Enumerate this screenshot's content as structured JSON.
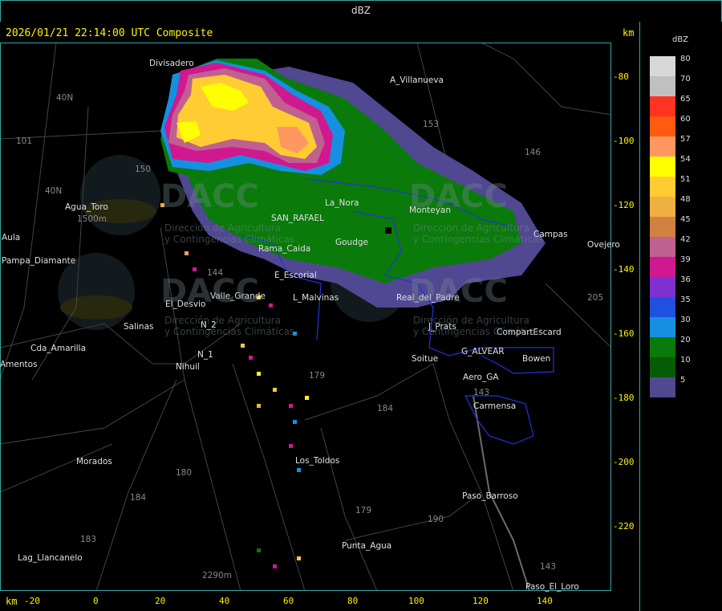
{
  "header": {
    "title": "dBZ"
  },
  "timestamp": "2026/01/21 22:14:00 UTC Composite",
  "axis": {
    "unit": "km",
    "y_ticks": [
      "-80",
      "-100",
      "-120",
      "-140",
      "-160",
      "-180",
      "-200",
      "-220"
    ],
    "x_ticks": [
      "-20",
      "0",
      "20",
      "40",
      "60",
      "80",
      "100",
      "120",
      "140"
    ]
  },
  "legend": {
    "title": "dBZ",
    "entries": [
      {
        "label": "80",
        "color": "#d8d8d8"
      },
      {
        "label": "70",
        "color": "#c0c0c0"
      },
      {
        "label": "65",
        "color": "#ff3322"
      },
      {
        "label": "60",
        "color": "#ff5a10"
      },
      {
        "label": "57",
        "color": "#ff9860"
      },
      {
        "label": "54",
        "color": "#ffff00"
      },
      {
        "label": "51",
        "color": "#ffcc33"
      },
      {
        "label": "48",
        "color": "#f0b040"
      },
      {
        "label": "45",
        "color": "#d08040"
      },
      {
        "label": "42",
        "color": "#c06090"
      },
      {
        "label": "39",
        "color": "#d01890"
      },
      {
        "label": "36",
        "color": "#8030d0"
      },
      {
        "label": "35",
        "color": "#2050e0"
      },
      {
        "label": "30",
        "color": "#1590e0"
      },
      {
        "label": "20",
        "color": "#0a7a0a"
      },
      {
        "label": "10",
        "color": "#055c05"
      },
      {
        "label": "5",
        "color": "#504890"
      }
    ]
  },
  "places": [
    {
      "name": "Divisadero"
    },
    {
      "name": "A_Villanueva"
    },
    {
      "name": "40N"
    },
    {
      "name": "101"
    },
    {
      "name": "150"
    },
    {
      "name": "153"
    },
    {
      "name": "146"
    },
    {
      "name": "40N"
    },
    {
      "name": "Agua_Toro"
    },
    {
      "name": "1500m"
    },
    {
      "name": "Aula"
    },
    {
      "name": "Pampa_Diamante"
    },
    {
      "name": "Los_Toldos"
    },
    {
      "name": "Salinas"
    },
    {
      "name": "Cda_Amarilla"
    },
    {
      "name": "Amentos"
    },
    {
      "name": "El_Desvio"
    },
    {
      "name": "Valle_Grande"
    },
    {
      "name": "N_2"
    },
    {
      "name": "N_1"
    },
    {
      "name": "Nihuil"
    },
    {
      "name": "Morados"
    },
    {
      "name": "180"
    },
    {
      "name": "184"
    },
    {
      "name": "183"
    },
    {
      "name": "Lag_Llancanelo"
    },
    {
      "name": "Punta_Agua"
    },
    {
      "name": "2290m"
    },
    {
      "name": "179"
    },
    {
      "name": "190"
    },
    {
      "name": "Paso_Barroso"
    },
    {
      "name": "Paso_El_Loro"
    },
    {
      "name": "143"
    },
    {
      "name": "Carmensa"
    },
    {
      "name": "Aero_GA"
    },
    {
      "name": "143"
    },
    {
      "name": "G_ALVEAR"
    },
    {
      "name": "Bowen"
    },
    {
      "name": "Soitue"
    },
    {
      "name": "J_Prats"
    },
    {
      "name": "CompartEscard"
    },
    {
      "name": "205"
    },
    {
      "name": "Ovejero"
    },
    {
      "name": "Campas"
    },
    {
      "name": "La_Nora"
    },
    {
      "name": "SAN_RAFAEL"
    },
    {
      "name": "E_Escorial"
    },
    {
      "name": "L_Malvinas"
    },
    {
      "name": "Monteyan"
    },
    {
      "name": "Goudge"
    },
    {
      "name": "Rama_Caida"
    },
    {
      "name": "184"
    },
    {
      "name": "179"
    },
    {
      "name": "144"
    },
    {
      "name": "Real_del_Padre"
    }
  ],
  "watermarks": {
    "logo": "DACC",
    "line1": "Dirección de Agricultura",
    "line2": "y Contingencias Climáticas"
  }
}
